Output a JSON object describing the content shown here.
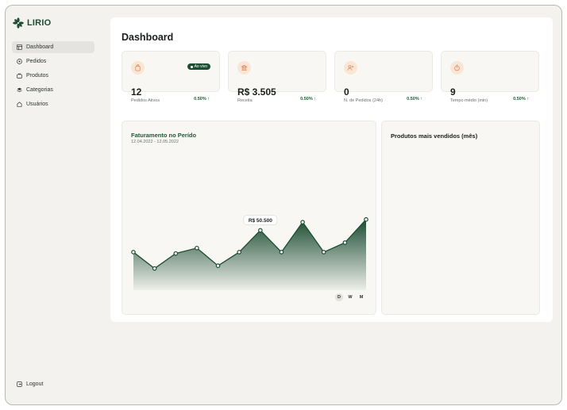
{
  "brand": {
    "name": "LIRIO"
  },
  "sidebar": {
    "items": [
      {
        "label": "Dashboard",
        "icon": "dashboard-icon",
        "active": true
      },
      {
        "label": "Pedidos",
        "icon": "pedidos-icon"
      },
      {
        "label": "Produtos",
        "icon": "produtos-icon"
      },
      {
        "label": "Categorias",
        "icon": "categorias-icon"
      },
      {
        "label": "Usuários",
        "icon": "usuarios-icon"
      }
    ],
    "logout": "Logout"
  },
  "main": {
    "title": "Dashboard",
    "cards": [
      {
        "value": "12",
        "label": "Pedidos Ativos",
        "delta": "0.50% ↑",
        "badge": "Ao vivo",
        "icon": "shopping-bag-icon"
      },
      {
        "value": "R$ 3.505",
        "label": "Receita",
        "delta": "0.50% ↑",
        "icon": "bank-icon"
      },
      {
        "value": "0",
        "label": "N. de Pedidos (24h)",
        "delta": "0.50% ↑",
        "icon": "users-icon"
      },
      {
        "value": "9",
        "label": "Tempo médio (min)",
        "delta": "0.50% ↑",
        "icon": "timer-icon"
      }
    ]
  },
  "revenue_panel": {
    "title": "Faturamento no Perído",
    "range": "12.04.2022 - 12.05.2022",
    "tooltip": "R$ 50.500",
    "periods": [
      "D",
      "W",
      "M"
    ],
    "selected_period": "D"
  },
  "products_panel": {
    "title": "Produtos mais vendidos (mês)"
  },
  "colors": {
    "accent": "#1d4d33",
    "icon_bg": "#fbe6d6",
    "icon_fg": "#e0895a"
  },
  "chart_data": {
    "type": "area",
    "x": [
      1,
      2,
      3,
      4,
      5,
      6,
      7,
      8,
      9,
      10,
      11,
      12
    ],
    "values": [
      28,
      16,
      27,
      31,
      18,
      28,
      44,
      28,
      50,
      28,
      35,
      52
    ],
    "ylim": [
      0,
      60
    ],
    "highlight_index": 6
  }
}
